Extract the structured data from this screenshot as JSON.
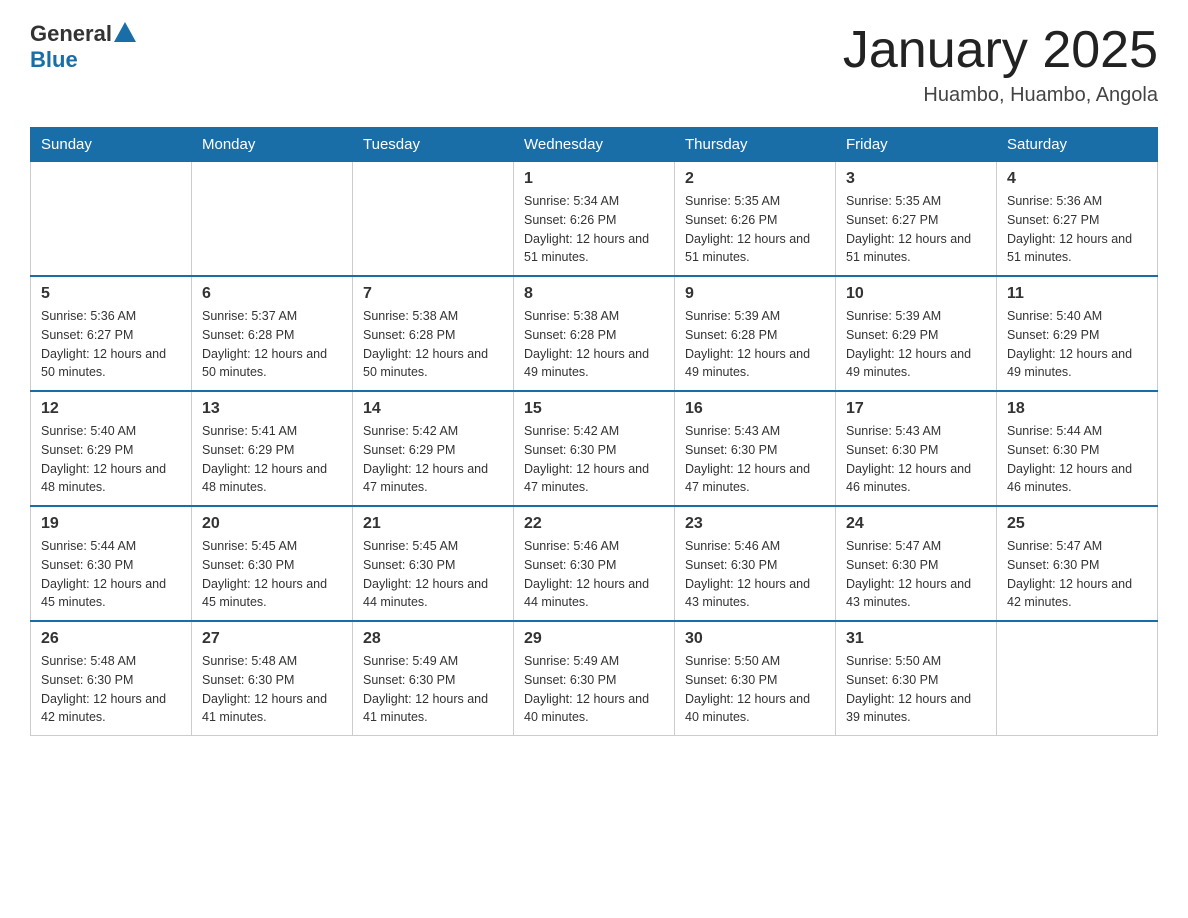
{
  "header": {
    "logo_general": "General",
    "logo_blue": "Blue",
    "month_title": "January 2025",
    "location": "Huambo, Huambo, Angola"
  },
  "days_of_week": [
    "Sunday",
    "Monday",
    "Tuesday",
    "Wednesday",
    "Thursday",
    "Friday",
    "Saturday"
  ],
  "weeks": [
    [
      {
        "day": "",
        "info": ""
      },
      {
        "day": "",
        "info": ""
      },
      {
        "day": "",
        "info": ""
      },
      {
        "day": "1",
        "info": "Sunrise: 5:34 AM\nSunset: 6:26 PM\nDaylight: 12 hours and 51 minutes."
      },
      {
        "day": "2",
        "info": "Sunrise: 5:35 AM\nSunset: 6:26 PM\nDaylight: 12 hours and 51 minutes."
      },
      {
        "day": "3",
        "info": "Sunrise: 5:35 AM\nSunset: 6:27 PM\nDaylight: 12 hours and 51 minutes."
      },
      {
        "day": "4",
        "info": "Sunrise: 5:36 AM\nSunset: 6:27 PM\nDaylight: 12 hours and 51 minutes."
      }
    ],
    [
      {
        "day": "5",
        "info": "Sunrise: 5:36 AM\nSunset: 6:27 PM\nDaylight: 12 hours and 50 minutes."
      },
      {
        "day": "6",
        "info": "Sunrise: 5:37 AM\nSunset: 6:28 PM\nDaylight: 12 hours and 50 minutes."
      },
      {
        "day": "7",
        "info": "Sunrise: 5:38 AM\nSunset: 6:28 PM\nDaylight: 12 hours and 50 minutes."
      },
      {
        "day": "8",
        "info": "Sunrise: 5:38 AM\nSunset: 6:28 PM\nDaylight: 12 hours and 49 minutes."
      },
      {
        "day": "9",
        "info": "Sunrise: 5:39 AM\nSunset: 6:28 PM\nDaylight: 12 hours and 49 minutes."
      },
      {
        "day": "10",
        "info": "Sunrise: 5:39 AM\nSunset: 6:29 PM\nDaylight: 12 hours and 49 minutes."
      },
      {
        "day": "11",
        "info": "Sunrise: 5:40 AM\nSunset: 6:29 PM\nDaylight: 12 hours and 49 minutes."
      }
    ],
    [
      {
        "day": "12",
        "info": "Sunrise: 5:40 AM\nSunset: 6:29 PM\nDaylight: 12 hours and 48 minutes."
      },
      {
        "day": "13",
        "info": "Sunrise: 5:41 AM\nSunset: 6:29 PM\nDaylight: 12 hours and 48 minutes."
      },
      {
        "day": "14",
        "info": "Sunrise: 5:42 AM\nSunset: 6:29 PM\nDaylight: 12 hours and 47 minutes."
      },
      {
        "day": "15",
        "info": "Sunrise: 5:42 AM\nSunset: 6:30 PM\nDaylight: 12 hours and 47 minutes."
      },
      {
        "day": "16",
        "info": "Sunrise: 5:43 AM\nSunset: 6:30 PM\nDaylight: 12 hours and 47 minutes."
      },
      {
        "day": "17",
        "info": "Sunrise: 5:43 AM\nSunset: 6:30 PM\nDaylight: 12 hours and 46 minutes."
      },
      {
        "day": "18",
        "info": "Sunrise: 5:44 AM\nSunset: 6:30 PM\nDaylight: 12 hours and 46 minutes."
      }
    ],
    [
      {
        "day": "19",
        "info": "Sunrise: 5:44 AM\nSunset: 6:30 PM\nDaylight: 12 hours and 45 minutes."
      },
      {
        "day": "20",
        "info": "Sunrise: 5:45 AM\nSunset: 6:30 PM\nDaylight: 12 hours and 45 minutes."
      },
      {
        "day": "21",
        "info": "Sunrise: 5:45 AM\nSunset: 6:30 PM\nDaylight: 12 hours and 44 minutes."
      },
      {
        "day": "22",
        "info": "Sunrise: 5:46 AM\nSunset: 6:30 PM\nDaylight: 12 hours and 44 minutes."
      },
      {
        "day": "23",
        "info": "Sunrise: 5:46 AM\nSunset: 6:30 PM\nDaylight: 12 hours and 43 minutes."
      },
      {
        "day": "24",
        "info": "Sunrise: 5:47 AM\nSunset: 6:30 PM\nDaylight: 12 hours and 43 minutes."
      },
      {
        "day": "25",
        "info": "Sunrise: 5:47 AM\nSunset: 6:30 PM\nDaylight: 12 hours and 42 minutes."
      }
    ],
    [
      {
        "day": "26",
        "info": "Sunrise: 5:48 AM\nSunset: 6:30 PM\nDaylight: 12 hours and 42 minutes."
      },
      {
        "day": "27",
        "info": "Sunrise: 5:48 AM\nSunset: 6:30 PM\nDaylight: 12 hours and 41 minutes."
      },
      {
        "day": "28",
        "info": "Sunrise: 5:49 AM\nSunset: 6:30 PM\nDaylight: 12 hours and 41 minutes."
      },
      {
        "day": "29",
        "info": "Sunrise: 5:49 AM\nSunset: 6:30 PM\nDaylight: 12 hours and 40 minutes."
      },
      {
        "day": "30",
        "info": "Sunrise: 5:50 AM\nSunset: 6:30 PM\nDaylight: 12 hours and 40 minutes."
      },
      {
        "day": "31",
        "info": "Sunrise: 5:50 AM\nSunset: 6:30 PM\nDaylight: 12 hours and 39 minutes."
      },
      {
        "day": "",
        "info": ""
      }
    ]
  ]
}
